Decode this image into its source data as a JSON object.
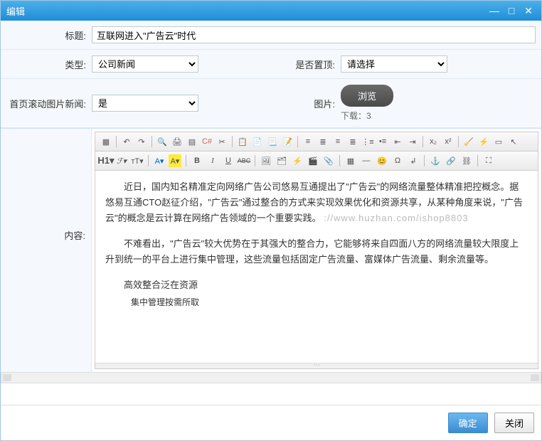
{
  "window": {
    "title": "编辑"
  },
  "form": {
    "title_label": "标题:",
    "title_value": "互联网进入\"广告云\"时代",
    "type_label": "类型:",
    "type_value": "公司新闻",
    "top_label": "是否置顶:",
    "top_value": "请选择",
    "scroll_label": "首页滚动图片新闻:",
    "scroll_value": "是",
    "pic_label": "图片:",
    "browse_btn": "浏览",
    "download_text": "下载：3",
    "content_label": "内容:"
  },
  "toolbar2": {
    "h1": "H1▾",
    "f": "ℱ▾",
    "tt": "тT▾",
    "a": "A▾",
    "a_hl": "A▾",
    "b": "B",
    "i": "I",
    "u": "U",
    "s": "ABC"
  },
  "content": {
    "p1": "近日，国内知名精准定向网络广告公司悠易互通提出了\"广告云\"的网络流量整体精准把控概念。据悠易互通CTO赵征介绍，\"广告云\"通过整合的方式来实现效果优化和资源共享，从某种角度来说，\"广告云\"的概念是云计算在网络广告领域的一个重要实践。",
    "watermark": "://www.huzhan.com/ishop8803",
    "p2": "不难看出，\"广告云\"较大优势在于其强大的整合力，它能够将来自四面八方的网络流量较大限度上升到统一的平台上进行集中管理，这些流量包括固定广告流量、富媒体广告流量、剩余流量等。",
    "p3": "高效整合泛在资源",
    "p4": "集中管理按需所取"
  },
  "footer": {
    "ok": "确定",
    "close": "关闭"
  }
}
